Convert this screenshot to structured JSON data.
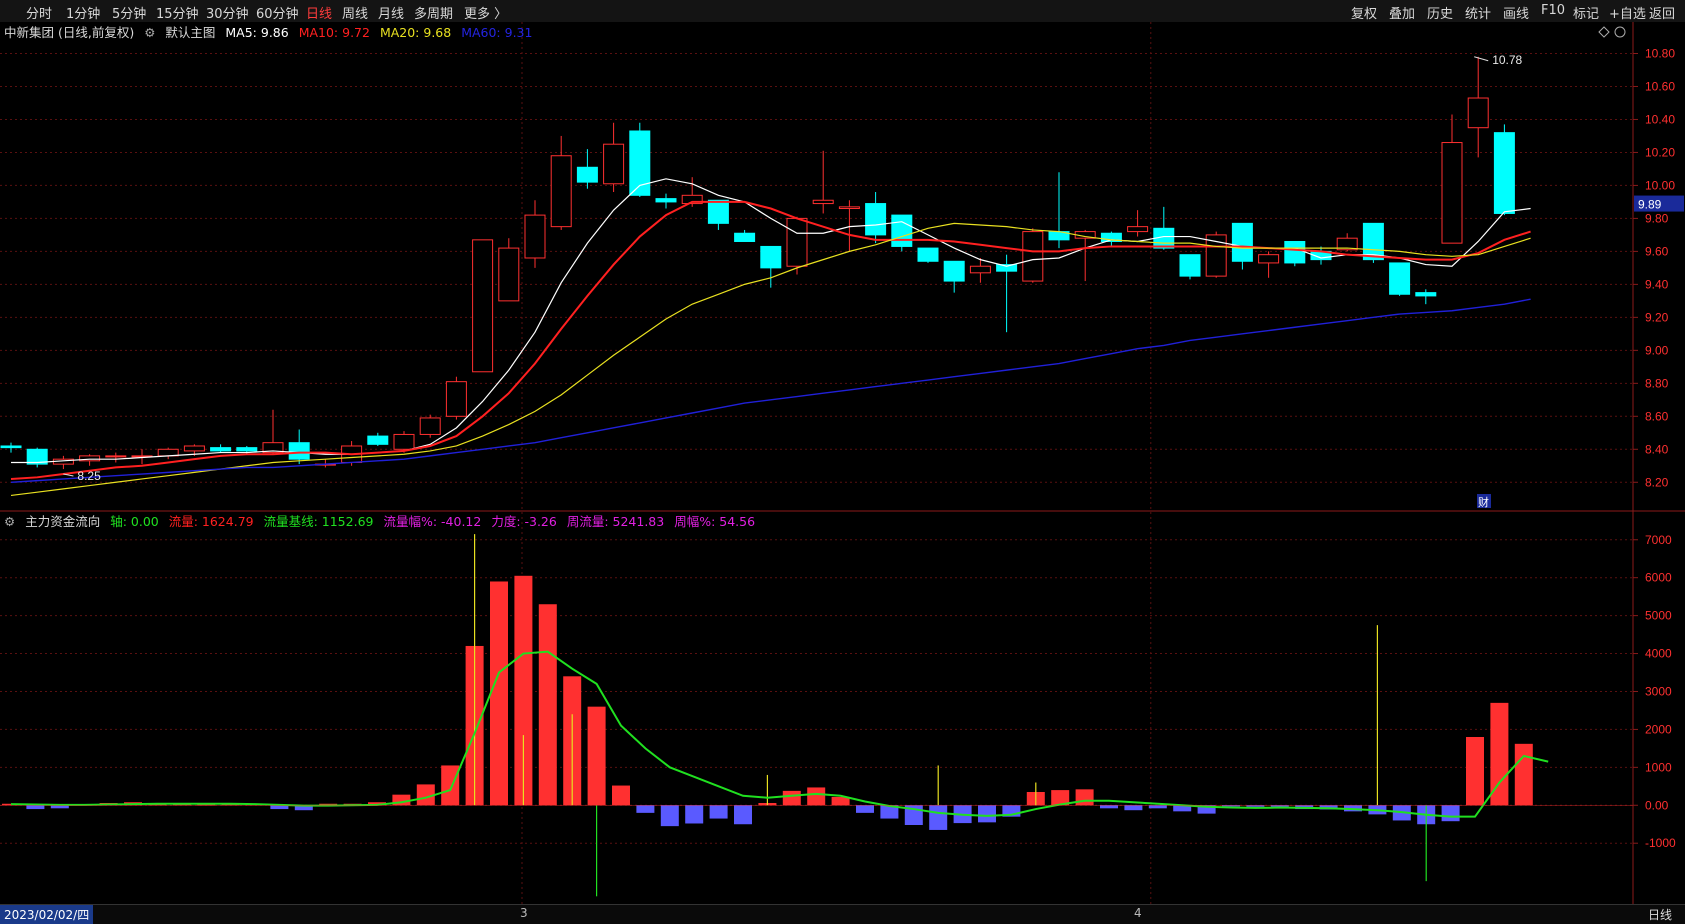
{
  "toolbar": {
    "periods": [
      "分时",
      "1分钟",
      "5分钟",
      "15分钟",
      "30分钟",
      "60分钟",
      "日线",
      "周线",
      "月线",
      "多周期",
      "更多 〉"
    ],
    "active_period": "日线",
    "right_items": [
      "复权",
      "叠加",
      "历史",
      "统计",
      "画线",
      "F10",
      "标记",
      "+自选",
      "返回"
    ]
  },
  "main_legend": {
    "stock": "中新集团 (日线,前复权)",
    "indicator": "默认主图",
    "ma5": "MA5: 9.86",
    "ma10": "MA10: 9.72",
    "ma20": "MA20: 9.68",
    "ma60": "MA60: 9.31"
  },
  "sub_legend": {
    "name": "主力资金流向",
    "axis": "轴: 0.00",
    "flow": "流量: 1624.79",
    "baseline": "流量基线: 1152.69",
    "flow_pct": "流量幅%: -40.12",
    "strength": "力度: -3.26",
    "week_flow": "周流量: 5241.83",
    "week_pct": "周幅%: 54.56"
  },
  "annotations": {
    "high": "10.78",
    "low": "8.25",
    "last_price": "9.89",
    "cai_icon": "财"
  },
  "bottom": {
    "date": "2023/02/02/四",
    "month3": "3",
    "month4": "4",
    "period": "日线"
  },
  "colors": {
    "up": "#ff3030",
    "down": "#00ffff",
    "ma5": "#ffffff",
    "ma10": "#ff2020",
    "ma20": "#e8e020",
    "ma60": "#2020d8",
    "baseline": "#20e020",
    "neg_bar": "#5a5aff"
  },
  "chart_data": [
    {
      "type": "candlestick",
      "title": "中新集团 (日线,前复权)",
      "y_axis_ticks": [
        "10.80",
        "10.60",
        "10.40",
        "10.20",
        "10.00",
        "9.80",
        "9.60",
        "9.40",
        "9.20",
        "9.00",
        "8.80",
        "8.60",
        "8.40",
        "8.20"
      ],
      "ylim": [
        8.05,
        10.9
      ],
      "candles": [
        {
          "o": 8.42,
          "h": 8.44,
          "l": 8.38,
          "c": 8.41
        },
        {
          "o": 8.4,
          "h": 8.41,
          "l": 8.29,
          "c": 8.31
        },
        {
          "o": 8.31,
          "h": 8.36,
          "l": 8.28,
          "c": 8.34
        },
        {
          "o": 8.33,
          "h": 8.37,
          "l": 8.3,
          "c": 8.36
        },
        {
          "o": 8.36,
          "h": 8.38,
          "l": 8.32,
          "c": 8.36
        },
        {
          "o": 8.36,
          "h": 8.4,
          "l": 8.31,
          "c": 8.36
        },
        {
          "o": 8.36,
          "h": 8.41,
          "l": 8.34,
          "c": 8.4
        },
        {
          "o": 8.39,
          "h": 8.43,
          "l": 8.36,
          "c": 8.42
        },
        {
          "o": 8.41,
          "h": 8.43,
          "l": 8.38,
          "c": 8.39
        },
        {
          "o": 8.41,
          "h": 8.42,
          "l": 8.37,
          "c": 8.39
        },
        {
          "o": 8.38,
          "h": 8.64,
          "l": 8.37,
          "c": 8.44
        },
        {
          "o": 8.44,
          "h": 8.52,
          "l": 8.31,
          "c": 8.34
        },
        {
          "o": 8.31,
          "h": 8.34,
          "l": 8.29,
          "c": 8.31
        },
        {
          "o": 8.32,
          "h": 8.45,
          "l": 8.3,
          "c": 8.42
        },
        {
          "o": 8.48,
          "h": 8.5,
          "l": 8.42,
          "c": 8.43
        },
        {
          "o": 8.4,
          "h": 8.51,
          "l": 8.38,
          "c": 8.49
        },
        {
          "o": 8.49,
          "h": 8.61,
          "l": 8.47,
          "c": 8.59
        },
        {
          "o": 8.6,
          "h": 8.84,
          "l": 8.58,
          "c": 8.81
        },
        {
          "o": 8.87,
          "h": 9.67,
          "l": 8.87,
          "c": 9.67
        },
        {
          "o": 9.3,
          "h": 9.68,
          "l": 9.3,
          "c": 9.62
        },
        {
          "o": 9.56,
          "h": 9.91,
          "l": 9.5,
          "c": 9.82
        },
        {
          "o": 9.75,
          "h": 10.3,
          "l": 9.73,
          "c": 10.18
        },
        {
          "o": 10.11,
          "h": 10.22,
          "l": 9.98,
          "c": 10.02
        },
        {
          "o": 10.01,
          "h": 10.38,
          "l": 9.96,
          "c": 10.25
        },
        {
          "o": 10.33,
          "h": 10.38,
          "l": 9.93,
          "c": 9.94
        },
        {
          "o": 9.92,
          "h": 9.95,
          "l": 9.86,
          "c": 9.9
        },
        {
          "o": 9.89,
          "h": 10.05,
          "l": 9.87,
          "c": 9.94
        },
        {
          "o": 9.91,
          "h": 9.91,
          "l": 9.73,
          "c": 9.77
        },
        {
          "o": 9.71,
          "h": 9.73,
          "l": 9.66,
          "c": 9.66
        },
        {
          "o": 9.63,
          "h": 9.63,
          "l": 9.38,
          "c": 9.5
        },
        {
          "o": 9.51,
          "h": 9.81,
          "l": 9.46,
          "c": 9.8
        },
        {
          "o": 9.89,
          "h": 10.21,
          "l": 9.83,
          "c": 9.91
        },
        {
          "o": 9.86,
          "h": 9.91,
          "l": 9.6,
          "c": 9.87
        },
        {
          "o": 9.89,
          "h": 9.96,
          "l": 9.65,
          "c": 9.7
        },
        {
          "o": 9.82,
          "h": 9.82,
          "l": 9.6,
          "c": 9.63
        },
        {
          "o": 9.62,
          "h": 9.62,
          "l": 9.53,
          "c": 9.54
        },
        {
          "o": 9.54,
          "h": 9.53,
          "l": 9.35,
          "c": 9.42
        },
        {
          "o": 9.47,
          "h": 9.56,
          "l": 9.41,
          "c": 9.51
        },
        {
          "o": 9.52,
          "h": 9.58,
          "l": 9.11,
          "c": 9.48
        },
        {
          "o": 9.42,
          "h": 9.74,
          "l": 9.41,
          "c": 9.72
        },
        {
          "o": 9.72,
          "h": 10.08,
          "l": 9.62,
          "c": 9.67
        },
        {
          "o": 9.68,
          "h": 9.73,
          "l": 9.42,
          "c": 9.72
        },
        {
          "o": 9.71,
          "h": 9.72,
          "l": 9.63,
          "c": 9.66
        },
        {
          "o": 9.72,
          "h": 9.85,
          "l": 9.69,
          "c": 9.75
        },
        {
          "o": 9.74,
          "h": 9.87,
          "l": 9.61,
          "c": 9.62
        },
        {
          "o": 9.58,
          "h": 9.58,
          "l": 9.43,
          "c": 9.45
        },
        {
          "o": 9.45,
          "h": 9.72,
          "l": 9.44,
          "c": 9.7
        },
        {
          "o": 9.77,
          "h": 9.77,
          "l": 9.49,
          "c": 9.54
        },
        {
          "o": 9.53,
          "h": 9.6,
          "l": 9.44,
          "c": 9.58
        },
        {
          "o": 9.66,
          "h": 9.66,
          "l": 9.51,
          "c": 9.53
        },
        {
          "o": 9.6,
          "h": 9.63,
          "l": 9.52,
          "c": 9.55
        },
        {
          "o": 9.61,
          "h": 9.71,
          "l": 9.6,
          "c": 9.68
        },
        {
          "o": 9.77,
          "h": 9.77,
          "l": 9.53,
          "c": 9.55
        },
        {
          "o": 9.53,
          "h": 9.53,
          "l": 9.33,
          "c": 9.34
        },
        {
          "o": 9.35,
          "h": 9.37,
          "l": 9.28,
          "c": 9.33
        },
        {
          "o": 9.65,
          "h": 10.43,
          "l": 9.65,
          "c": 10.26
        },
        {
          "o": 10.35,
          "h": 10.78,
          "l": 10.17,
          "c": 10.53
        },
        {
          "o": 10.32,
          "h": 10.37,
          "l": 9.82,
          "c": 9.83
        }
      ],
      "ma5": [
        8.32,
        8.32,
        8.33,
        8.34,
        8.34,
        8.35,
        8.36,
        8.37,
        8.38,
        8.38,
        8.39,
        8.38,
        8.37,
        8.37,
        8.38,
        8.39,
        8.43,
        8.53,
        8.69,
        8.88,
        9.11,
        9.41,
        9.65,
        9.85,
        10.0,
        10.04,
        10.01,
        9.94,
        9.9,
        9.8,
        9.71,
        9.71,
        9.75,
        9.76,
        9.78,
        9.7,
        9.62,
        9.55,
        9.51,
        9.55,
        9.56,
        9.62,
        9.67,
        9.66,
        9.69,
        9.69,
        9.66,
        9.63,
        9.62,
        9.62,
        9.56,
        9.58,
        9.58,
        9.56,
        9.52,
        9.51,
        9.66,
        9.84,
        9.86
      ],
      "ma10": [
        8.22,
        8.23,
        8.25,
        8.27,
        8.29,
        8.3,
        8.32,
        8.34,
        8.36,
        8.37,
        8.37,
        8.38,
        8.38,
        8.37,
        8.38,
        8.39,
        8.42,
        8.48,
        8.6,
        8.74,
        8.92,
        9.13,
        9.33,
        9.52,
        9.69,
        9.82,
        9.9,
        9.9,
        9.9,
        9.86,
        9.8,
        9.75,
        9.7,
        9.67,
        9.67,
        9.67,
        9.66,
        9.64,
        9.62,
        9.6,
        9.6,
        9.62,
        9.63,
        9.63,
        9.63,
        9.63,
        9.63,
        9.63,
        9.62,
        9.61,
        9.6,
        9.58,
        9.57,
        9.56,
        9.55,
        9.55,
        9.59,
        9.67,
        9.72
      ],
      "ma20": [
        8.12,
        8.14,
        8.16,
        8.18,
        8.2,
        8.22,
        8.24,
        8.26,
        8.28,
        8.3,
        8.32,
        8.33,
        8.34,
        8.35,
        8.36,
        8.37,
        8.39,
        8.42,
        8.48,
        8.55,
        8.63,
        8.73,
        8.85,
        8.97,
        9.08,
        9.19,
        9.28,
        9.34,
        9.4,
        9.44,
        9.5,
        9.55,
        9.6,
        9.64,
        9.69,
        9.74,
        9.77,
        9.76,
        9.75,
        9.73,
        9.72,
        9.69,
        9.67,
        9.66,
        9.65,
        9.65,
        9.63,
        9.62,
        9.62,
        9.62,
        9.62,
        9.62,
        9.61,
        9.6,
        9.58,
        9.57,
        9.58,
        9.63,
        9.68
      ],
      "ma60": [
        8.2,
        8.21,
        8.22,
        8.23,
        8.24,
        8.25,
        8.26,
        8.27,
        8.28,
        8.29,
        8.29,
        8.3,
        8.31,
        8.32,
        8.33,
        8.34,
        8.36,
        8.38,
        8.4,
        8.42,
        8.44,
        8.47,
        8.5,
        8.53,
        8.56,
        8.59,
        8.62,
        8.65,
        8.68,
        8.7,
        8.72,
        8.74,
        8.76,
        8.78,
        8.8,
        8.82,
        8.84,
        8.86,
        8.88,
        8.9,
        8.92,
        8.95,
        8.98,
        9.01,
        9.03,
        9.06,
        9.08,
        9.1,
        9.12,
        9.14,
        9.16,
        9.18,
        9.2,
        9.22,
        9.23,
        9.24,
        9.26,
        9.28,
        9.31
      ]
    },
    {
      "type": "bar",
      "title": "主力资金流向",
      "y_axis_ticks": [
        "7000",
        "6000",
        "5000",
        "4000",
        "3000",
        "2000",
        "1000",
        "0.00",
        "-1000"
      ],
      "ylim": [
        -2550,
        7600
      ],
      "values": [
        40,
        -100,
        -80,
        20,
        60,
        80,
        60,
        40,
        20,
        40,
        30,
        -100,
        -130,
        40,
        40,
        80,
        280,
        550,
        1050,
        4200,
        5900,
        6050,
        5300,
        3400,
        2600,
        520,
        -200,
        -550,
        -480,
        -350,
        -500,
        60,
        380,
        470,
        220,
        -200,
        -350,
        -520,
        -650,
        -470,
        -450,
        -300,
        350,
        400,
        420,
        -80,
        -130,
        -80,
        -160,
        -220,
        -30,
        -40,
        -40,
        -100,
        -110,
        -160,
        -240,
        -400,
        -500,
        -420,
        1800,
        2700,
        1620
      ],
      "baseline": [
        30,
        20,
        10,
        10,
        20,
        30,
        40,
        40,
        40,
        40,
        30,
        10,
        -10,
        -10,
        0,
        10,
        80,
        200,
        400,
        1900,
        3500,
        4000,
        4050,
        3600,
        3200,
        2100,
        1500,
        1000,
        750,
        500,
        250,
        200,
        250,
        300,
        250,
        100,
        -20,
        -100,
        -200,
        -250,
        -280,
        -250,
        -100,
        20,
        120,
        120,
        80,
        40,
        0,
        -40,
        -60,
        -70,
        -60,
        -70,
        -80,
        -100,
        -130,
        -180,
        -250,
        -300,
        -300,
        600,
        1300,
        1150
      ],
      "spikes": [
        {
          "i": 19,
          "v": 7150
        },
        {
          "i": 21,
          "v": 1850
        },
        {
          "i": 23,
          "v": 2400
        },
        {
          "i": 24,
          "v": -2400
        },
        {
          "i": 31,
          "v": 800
        },
        {
          "i": 38,
          "v": 1050
        },
        {
          "i": 42,
          "v": 600
        },
        {
          "i": 56,
          "v": 4750
        },
        {
          "i": 58,
          "v": -2000
        }
      ]
    }
  ]
}
